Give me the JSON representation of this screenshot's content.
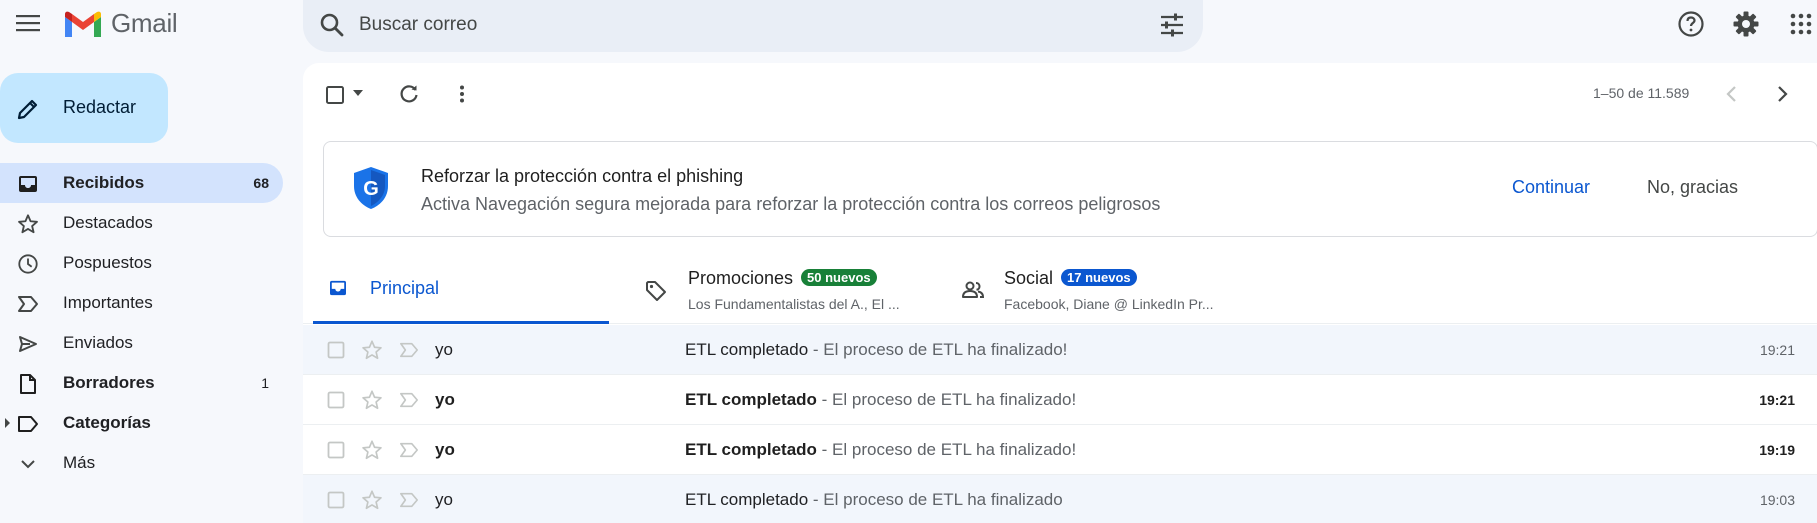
{
  "app": {
    "name": "Gmail"
  },
  "header": {
    "search_placeholder": "Buscar correo",
    "icons": [
      "menu-icon",
      "search-icon",
      "tune-icon",
      "help-icon",
      "settings-icon",
      "apps-icon"
    ]
  },
  "compose": {
    "label": "Redactar"
  },
  "sidebar": {
    "items": [
      {
        "label": "Recibidos",
        "count": "68",
        "icon": "inbox-icon"
      },
      {
        "label": "Destacados",
        "count": "",
        "icon": "star-icon"
      },
      {
        "label": "Pospuestos",
        "count": "",
        "icon": "clock-icon"
      },
      {
        "label": "Importantes",
        "count": "",
        "icon": "label-important-icon"
      },
      {
        "label": "Enviados",
        "count": "",
        "icon": "send-icon"
      },
      {
        "label": "Borradores",
        "count": "1",
        "icon": "draft-icon"
      },
      {
        "label": "Categorías",
        "count": "",
        "icon": "label-icon"
      },
      {
        "label": "Más",
        "count": "",
        "icon": "chevron-down-icon"
      }
    ]
  },
  "toolbar": {
    "pagination": "1–50 de 11.589"
  },
  "banner": {
    "title": "Reforzar la protección contra el phishing",
    "text": "Activa Navegación segura mejorada para reforzar la protección contra los correos peligrosos",
    "continue_label": "Continuar",
    "dismiss_label": "No, gracias"
  },
  "tabs": {
    "principal": {
      "label": "Principal"
    },
    "promociones": {
      "label": "Promociones",
      "badge": "50 nuevos",
      "snippet": "Los Fundamentalistas del A., El ...",
      "badge_color": "#188038"
    },
    "social": {
      "label": "Social",
      "badge": "17 nuevos",
      "snippet": "Facebook, Diane @ LinkedIn Pr...",
      "badge_color": "#0b57d0"
    }
  },
  "emails": [
    {
      "sender": "yo",
      "subject": "ETL completado",
      "snippet": " - El proceso de ETL ha finalizado!",
      "time": "19:21",
      "unread": false
    },
    {
      "sender": "yo",
      "subject": "ETL completado",
      "snippet": " - El proceso de ETL ha finalizado!",
      "time": "19:21",
      "unread": true
    },
    {
      "sender": "yo",
      "subject": "ETL completado",
      "snippet": " - El proceso de ETL ha finalizado!",
      "time": "19:19",
      "unread": true
    },
    {
      "sender": "yo",
      "subject": "ETL completado",
      "snippet": " - El proceso de ETL ha finalizado",
      "time": "19:03",
      "unread": false
    }
  ],
  "colors": {
    "accent": "#0b57d0",
    "compose_bg": "#c2e7ff",
    "active_nav": "#d3e3fd",
    "search_bg": "#e9eef6"
  }
}
